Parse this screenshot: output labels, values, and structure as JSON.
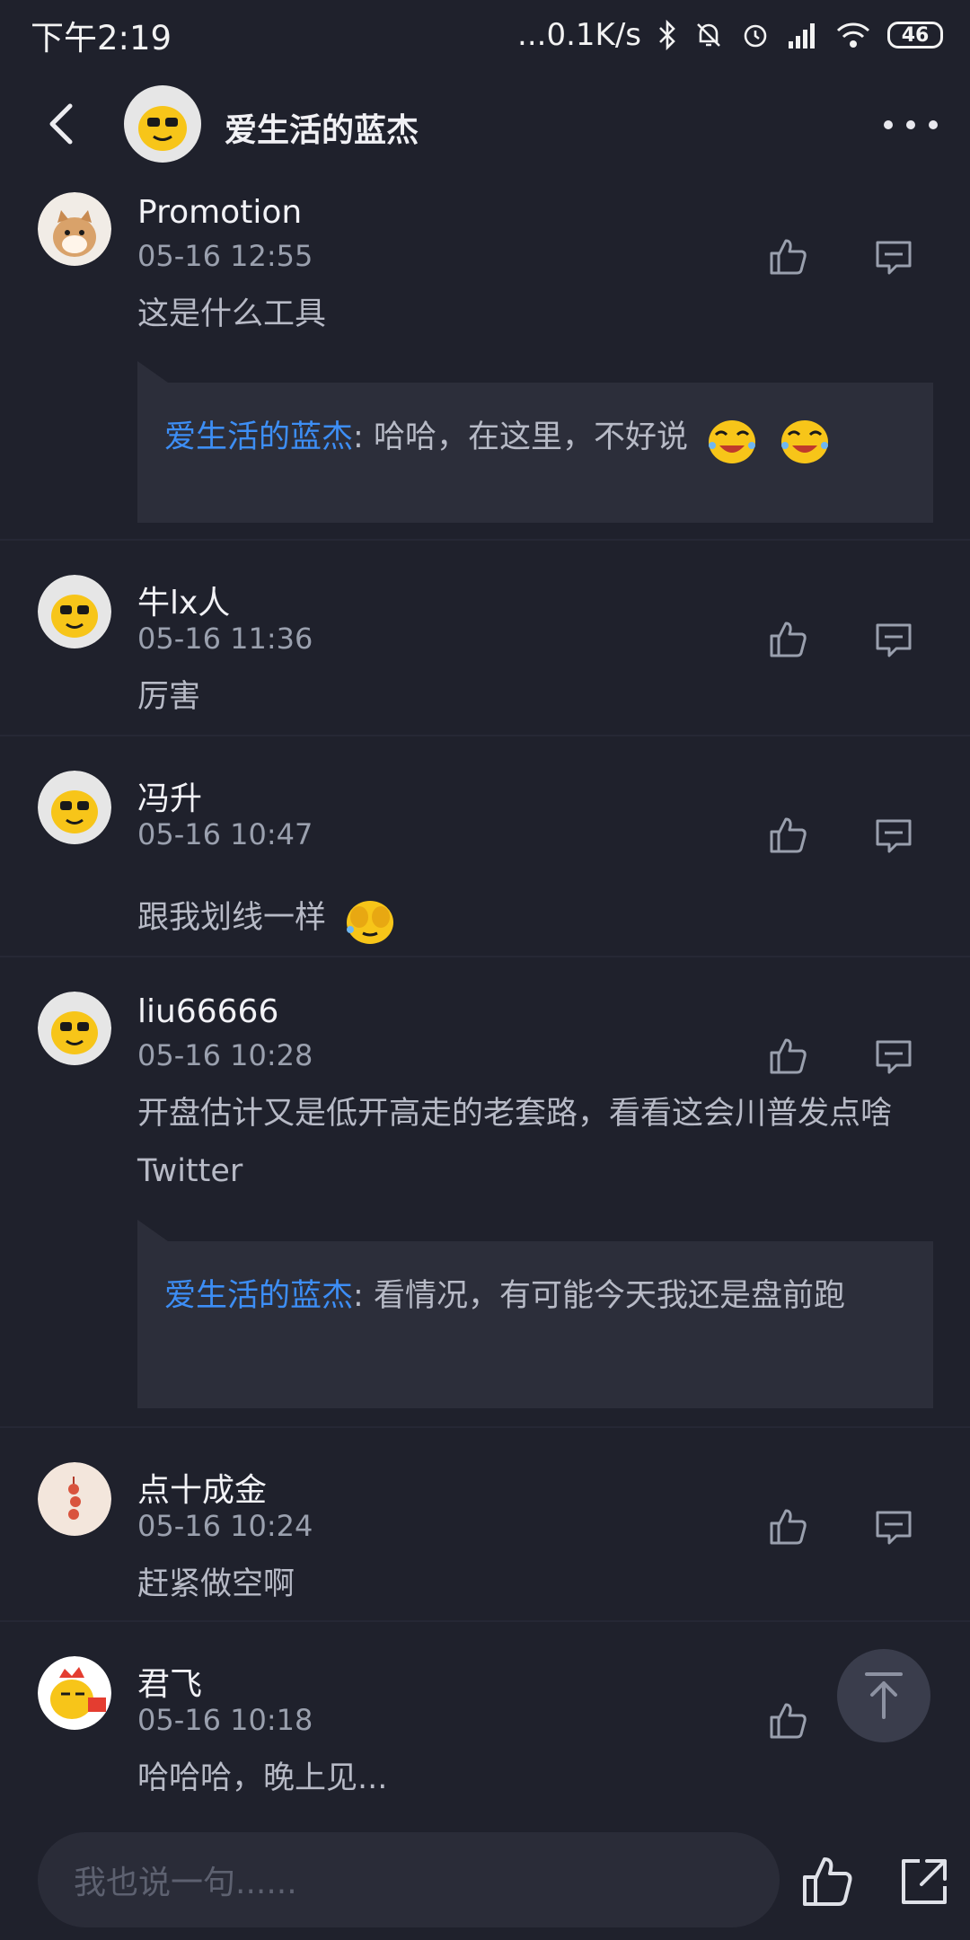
{
  "status_bar": {
    "time": "下午2:19",
    "network_speed": "...0.1K/s",
    "battery": "46"
  },
  "header": {
    "title": "爱生活的蓝杰"
  },
  "comments": [
    {
      "username": "Promotion",
      "time": "05-16 12:55",
      "text": "这是什么工具",
      "reply": {
        "author": "爱生活的蓝杰",
        "separator": ":",
        "text": " 哈哈，在这里，不好说"
      }
    },
    {
      "username": "牛lx人",
      "time": "05-16 11:36",
      "text": "厉害"
    },
    {
      "username": "冯升",
      "time": "05-16 10:47",
      "text": "跟我划线一样"
    },
    {
      "username": "liu66666",
      "time": "05-16 10:28",
      "text": "开盘估计又是低开高走的老套路，看看这会川普发点啥Twitter",
      "reply": {
        "author": "爱生活的蓝杰",
        "separator": ":",
        "text": " 看情况，有可能今天我还是盘前跑"
      }
    },
    {
      "username": "点十成金",
      "time": "05-16 10:24",
      "text": "赶紧做空啊"
    },
    {
      "username": "君飞",
      "time": "05-16 10:18",
      "text": "哈哈哈，晚上见..."
    }
  ],
  "bottom_bar": {
    "input_placeholder": "我也说一句......"
  },
  "colors": {
    "background": "#1f212c",
    "reply_background": "#2c2e3a",
    "reply_author": "#3d8ef5"
  }
}
